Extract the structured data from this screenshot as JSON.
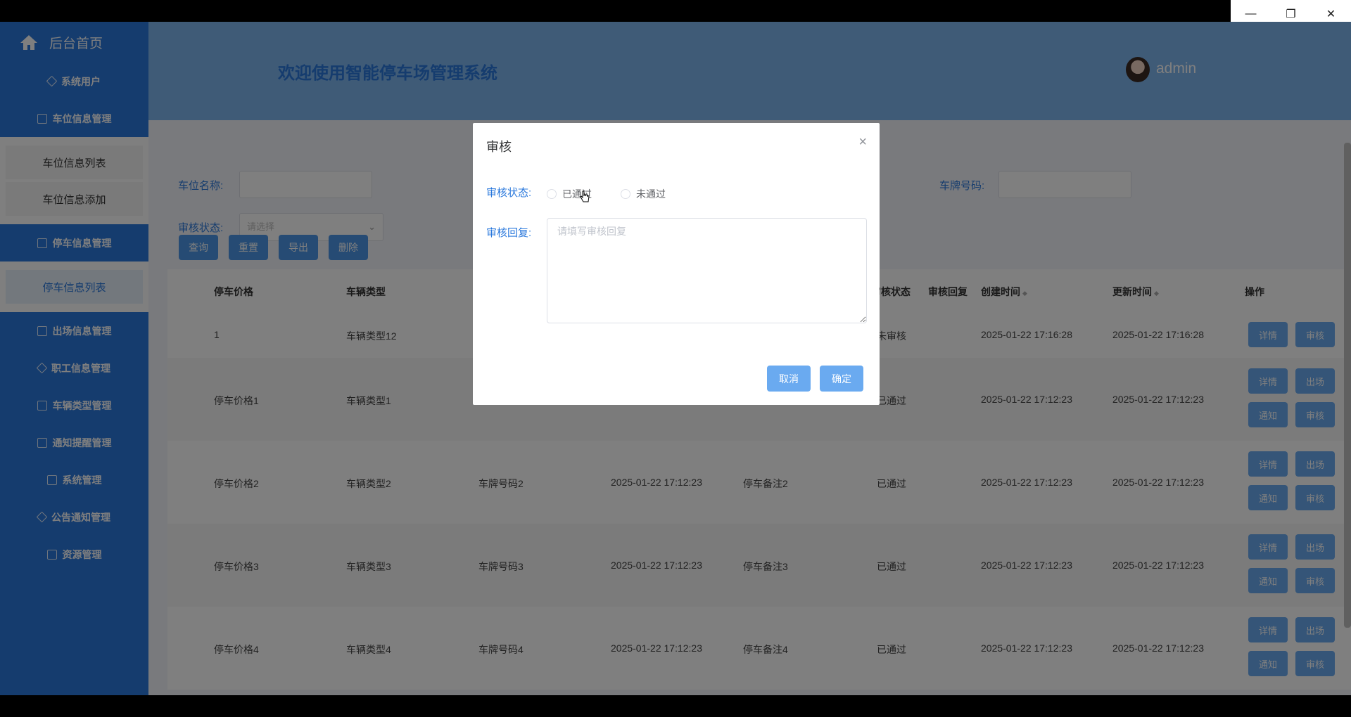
{
  "window_controls": {
    "minimize": "—",
    "restore": "❐",
    "close": "✕"
  },
  "sidebar": {
    "home": "后台首页",
    "items": [
      {
        "label": "系统用户"
      },
      {
        "label": "车位信息管理"
      },
      {
        "label": "停车信息管理"
      },
      {
        "label": "出场信息管理"
      },
      {
        "label": "职工信息管理"
      },
      {
        "label": "车辆类型管理"
      },
      {
        "label": "通知提醒管理"
      },
      {
        "label": "系统管理"
      },
      {
        "label": "公告通知管理"
      },
      {
        "label": "资源管理"
      }
    ],
    "sub_parking_space": [
      "车位信息列表",
      "车位信息添加"
    ],
    "sub_parking": [
      "停车信息列表"
    ]
  },
  "header": {
    "title": "欢迎使用智能停车场管理系统",
    "user": "admin"
  },
  "filters": {
    "space_name_label": "车位名称:",
    "plate_label": "车牌号码:",
    "audit_status_label": "审核状态:",
    "audit_status_placeholder": "请选择"
  },
  "toolbar": {
    "query": "查询",
    "reset": "重置",
    "export": "导出",
    "delete": "删除"
  },
  "table": {
    "headers": {
      "price": "停车价格",
      "type": "车辆类型",
      "audit_status": "审核状态",
      "audit_reply": "审核回复",
      "created": "创建时间",
      "updated": "更新时间",
      "ops": "操作"
    },
    "rows": [
      {
        "price": "1",
        "type": "车辆类型12",
        "plate": "",
        "time": "",
        "remark": "",
        "status": "未审核",
        "created": "2025-01-22 17:16:28",
        "updated": "2025-01-22 17:16:28"
      },
      {
        "price": "停车价格1",
        "type": "车辆类型1",
        "plate": "",
        "time": "",
        "remark": "",
        "status": "已通过",
        "created": "2025-01-22 17:12:23",
        "updated": "2025-01-22 17:12:23"
      },
      {
        "price": "停车价格2",
        "type": "车辆类型2",
        "plate": "车牌号码2",
        "time": "2025-01-22 17:12:23",
        "remark": "停车备注2",
        "status": "已通过",
        "created": "2025-01-22 17:12:23",
        "updated": "2025-01-22 17:12:23"
      },
      {
        "price": "停车价格3",
        "type": "车辆类型3",
        "plate": "车牌号码3",
        "time": "2025-01-22 17:12:23",
        "remark": "停车备注3",
        "status": "已通过",
        "created": "2025-01-22 17:12:23",
        "updated": "2025-01-22 17:12:23"
      },
      {
        "price": "停车价格4",
        "type": "车辆类型4",
        "plate": "车牌号码4",
        "time": "2025-01-22 17:12:23",
        "remark": "停车备注4",
        "status": "已通过",
        "created": "2025-01-22 17:12:23",
        "updated": "2025-01-22 17:12:23"
      }
    ],
    "actions": {
      "detail": "详情",
      "exit": "出场",
      "notify": "通知",
      "audit": "审核"
    }
  },
  "dialog": {
    "title": "审核",
    "close": "×",
    "status_label": "审核状态:",
    "option_pass": "已通过",
    "option_fail": "未通过",
    "reply_label": "审核回复:",
    "reply_placeholder": "请填写审核回复",
    "cancel": "取消",
    "confirm": "确定"
  },
  "colors": {
    "primary": "#2a78dc",
    "header_bg": "#7fb6ee",
    "button": "#6aaaf0"
  },
  "icons": {
    "home": "home-icon",
    "cursor": "hand-pointer-icon"
  }
}
